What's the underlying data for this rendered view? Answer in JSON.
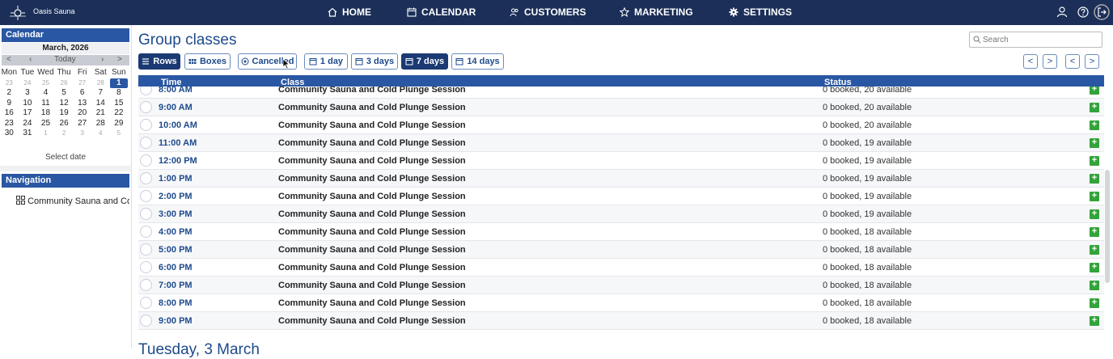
{
  "topbar": {
    "brand": "Oasis Sauna",
    "nav": [
      {
        "label": "HOME",
        "icon": "home-icon"
      },
      {
        "label": "CALENDAR",
        "icon": "calendar-icon"
      },
      {
        "label": "CUSTOMERS",
        "icon": "users-icon"
      },
      {
        "label": "MARKETING",
        "icon": "star-icon"
      },
      {
        "label": "SETTINGS",
        "icon": "gear-icon"
      }
    ],
    "right_icons": [
      "user-icon",
      "help-icon",
      "logout-icon"
    ]
  },
  "sidebar": {
    "calendar": {
      "heading": "Calendar",
      "month": "March, 2026",
      "controls": {
        "prev_month": "<",
        "prev": "‹",
        "today": "Today",
        "next": "›",
        "next_month": ">"
      },
      "weekdays": [
        "Mon",
        "Tue",
        "Wed",
        "Thu",
        "Fri",
        "Sat",
        "Sun"
      ],
      "weeks": [
        [
          "23",
          "24",
          "25",
          "26",
          "27",
          "28",
          "1"
        ],
        [
          "2",
          "3",
          "4",
          "5",
          "6",
          "7",
          "8"
        ],
        [
          "9",
          "10",
          "11",
          "12",
          "13",
          "14",
          "15"
        ],
        [
          "16",
          "17",
          "18",
          "19",
          "20",
          "21",
          "22"
        ],
        [
          "23",
          "24",
          "25",
          "26",
          "27",
          "28",
          "29"
        ],
        [
          "30",
          "31",
          "1",
          "2",
          "3",
          "4",
          "5"
        ]
      ],
      "selected_day": "1",
      "select_date": "Select date"
    },
    "navigation": {
      "heading": "Navigation",
      "item": "Community Sauna and Co"
    }
  },
  "main": {
    "title": "Group classes",
    "search_placeholder": "Search",
    "view_buttons": {
      "rows": "Rows",
      "boxes": "Boxes",
      "cancelled": "Cancelled"
    },
    "range_buttons": {
      "d1": "1 day",
      "d3": "3 days",
      "d7": "7 days",
      "d14": "14 days"
    },
    "active_view": "Rows",
    "active_range": "7 days",
    "pager": [
      "<",
      ">",
      "<",
      ">"
    ],
    "table": {
      "columns": {
        "time": "Time",
        "class": "Class",
        "status": "Status"
      },
      "rows": [
        {
          "time": "8:00 AM",
          "class": "Community Sauna and Cold Plunge Session",
          "status": "0 booked, 20 available"
        },
        {
          "time": "9:00 AM",
          "class": "Community Sauna and Cold Plunge Session",
          "status": "0 booked, 20 available"
        },
        {
          "time": "10:00 AM",
          "class": "Community Sauna and Cold Plunge Session",
          "status": "0 booked, 20 available"
        },
        {
          "time": "11:00 AM",
          "class": "Community Sauna and Cold Plunge Session",
          "status": "0 booked, 19 available"
        },
        {
          "time": "12:00 PM",
          "class": "Community Sauna and Cold Plunge Session",
          "status": "0 booked, 19 available"
        },
        {
          "time": "1:00 PM",
          "class": "Community Sauna and Cold Plunge Session",
          "status": "0 booked, 19 available"
        },
        {
          "time": "2:00 PM",
          "class": "Community Sauna and Cold Plunge Session",
          "status": "0 booked, 19 available"
        },
        {
          "time": "3:00 PM",
          "class": "Community Sauna and Cold Plunge Session",
          "status": "0 booked, 19 available"
        },
        {
          "time": "4:00 PM",
          "class": "Community Sauna and Cold Plunge Session",
          "status": "0 booked, 18 available"
        },
        {
          "time": "5:00 PM",
          "class": "Community Sauna and Cold Plunge Session",
          "status": "0 booked, 18 available"
        },
        {
          "time": "6:00 PM",
          "class": "Community Sauna and Cold Plunge Session",
          "status": "0 booked, 18 available"
        },
        {
          "time": "7:00 PM",
          "class": "Community Sauna and Cold Plunge Session",
          "status": "0 booked, 18 available"
        },
        {
          "time": "8:00 PM",
          "class": "Community Sauna and Cold Plunge Session",
          "status": "0 booked, 18 available"
        },
        {
          "time": "9:00 PM",
          "class": "Community Sauna and Cold Plunge Session",
          "status": "0 booked, 18 available"
        }
      ],
      "add_label": "+"
    },
    "next_section_title": "Tuesday, 3 March"
  },
  "colors": {
    "topbar": "#1b2f58",
    "accent": "#2a57a3",
    "title": "#1d4a8c",
    "add_button": "#34a33b"
  }
}
